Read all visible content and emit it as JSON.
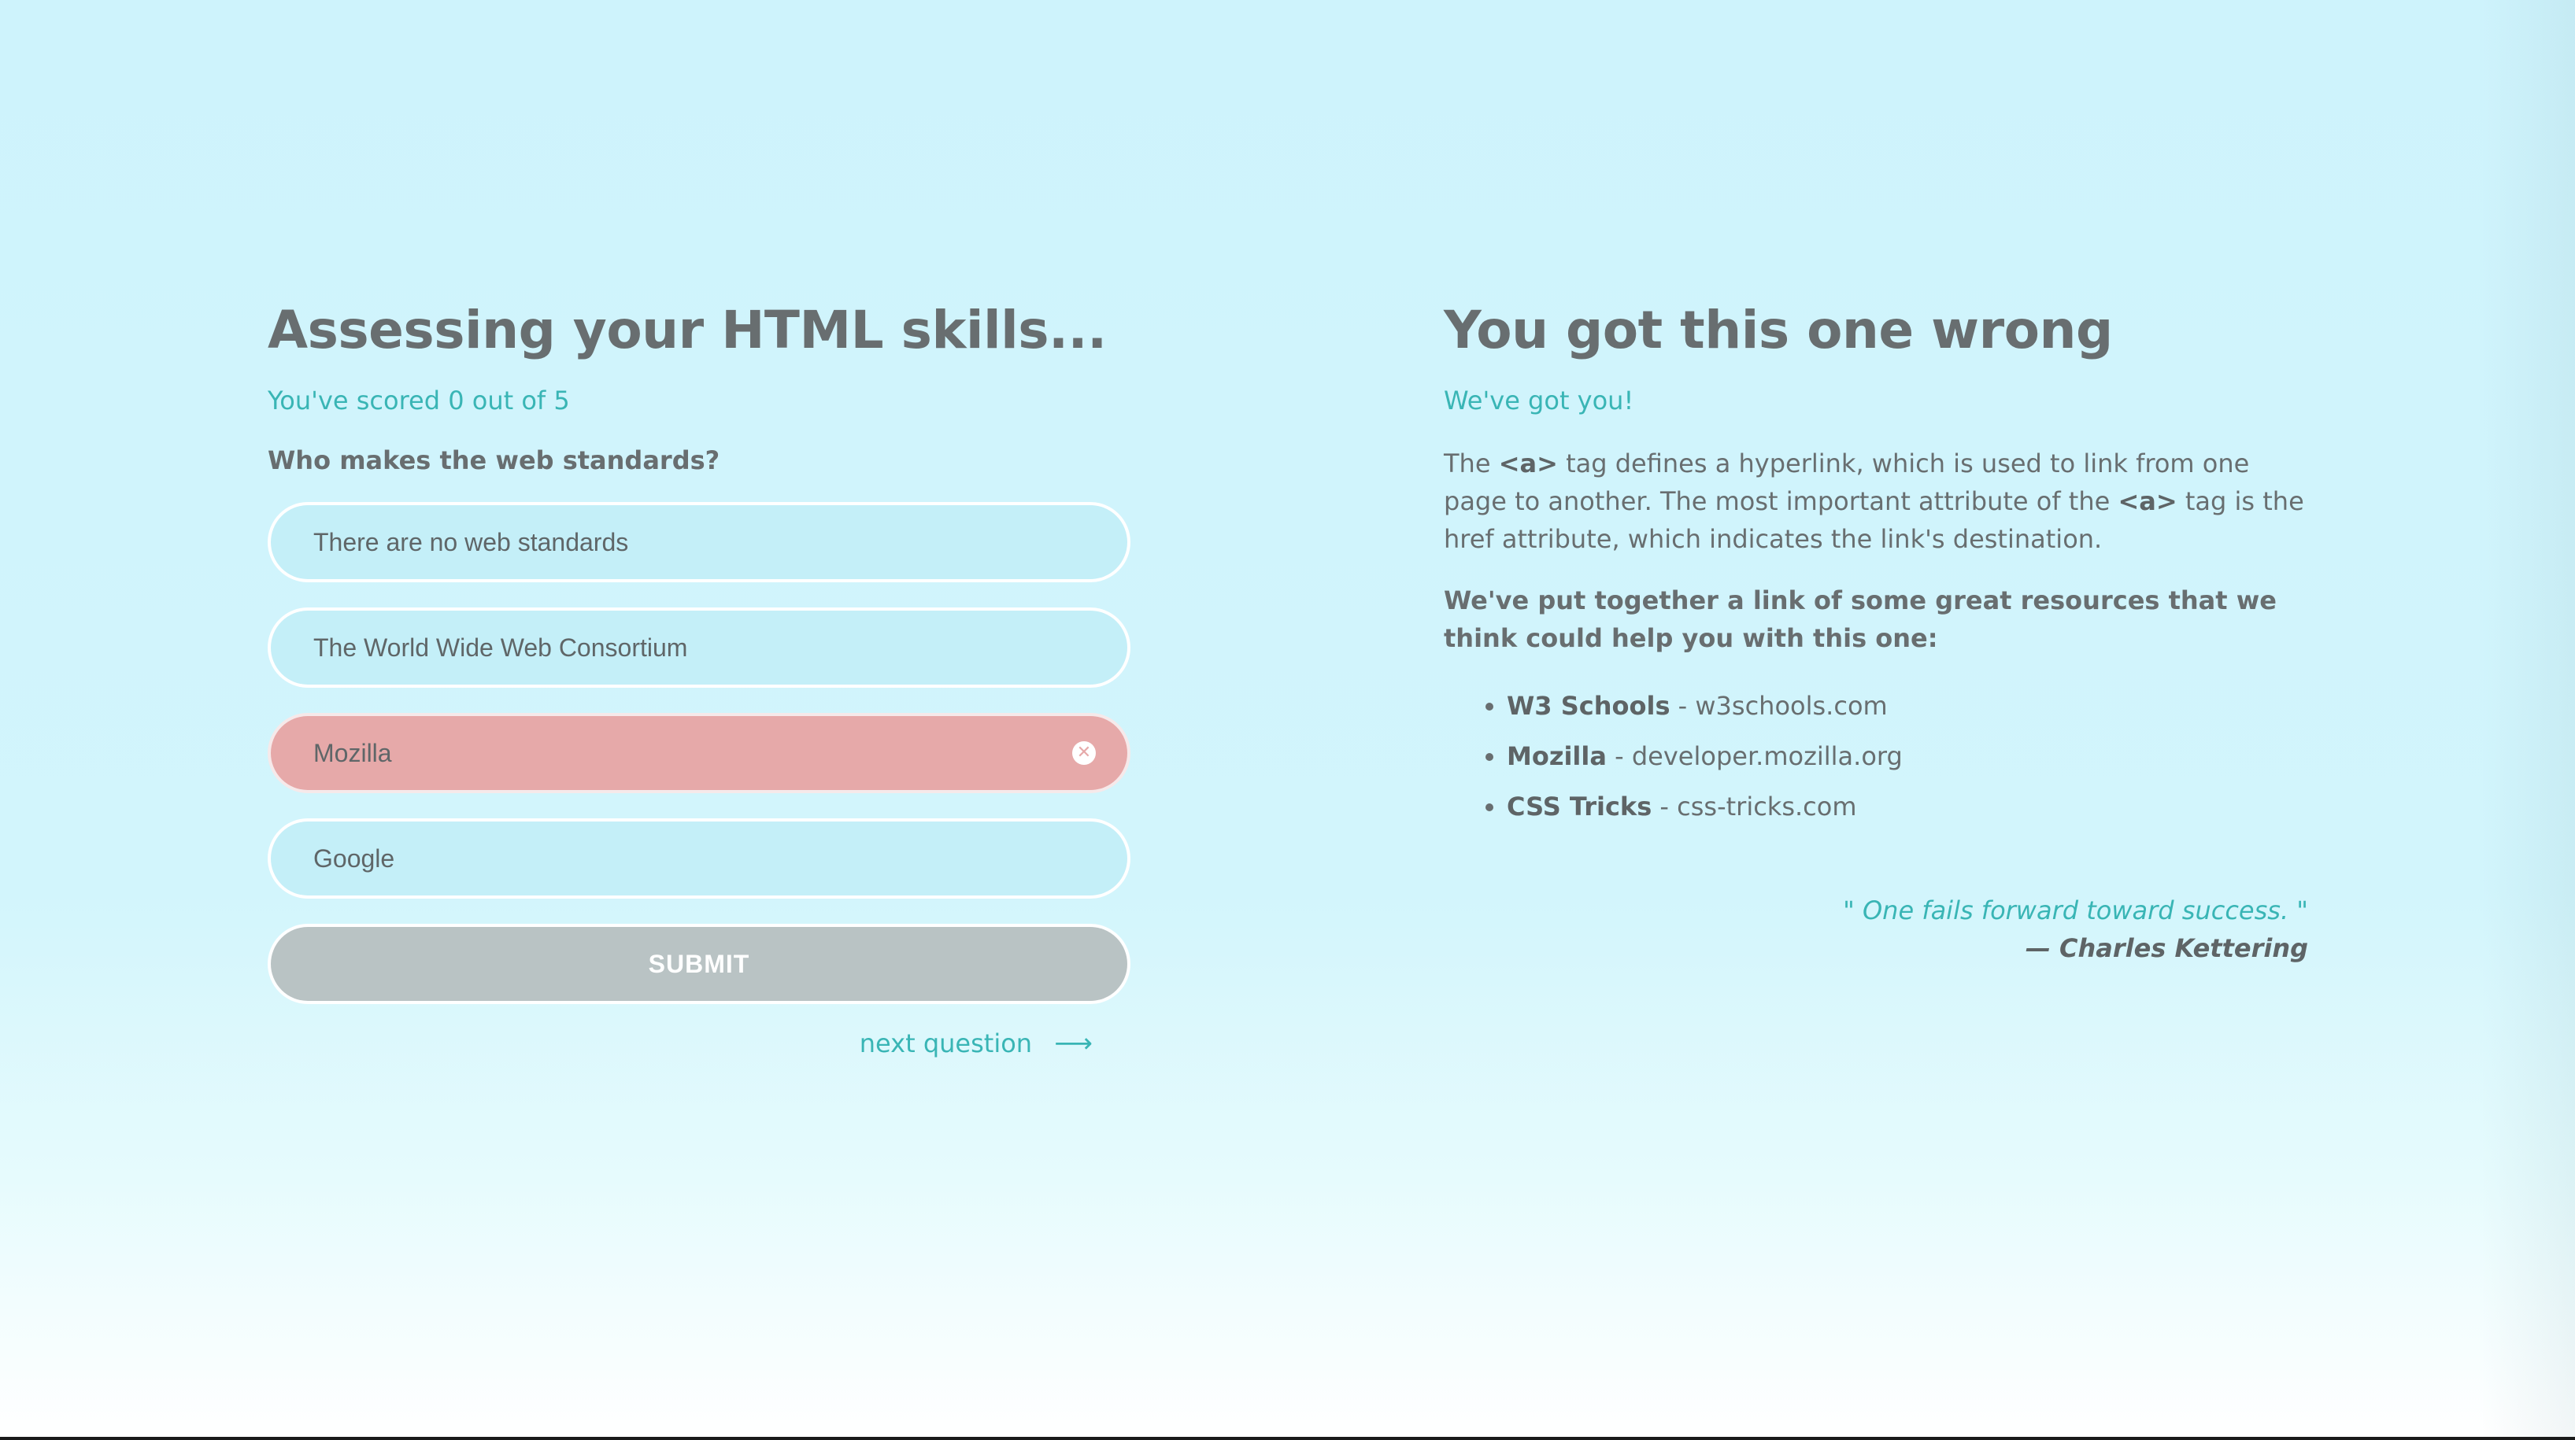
{
  "quiz": {
    "title": "Assessing your HTML skills...",
    "score_text": "You've scored 0 out of 5",
    "question": "Who makes the web standards?",
    "options": [
      {
        "label": "There are no web standards",
        "state": "default"
      },
      {
        "label": "The World Wide Web Consortium",
        "state": "default"
      },
      {
        "label": "Mozilla",
        "state": "wrong"
      },
      {
        "label": "Google",
        "state": "default"
      }
    ],
    "submit_label": "SUBMIT",
    "next_label": "next question",
    "next_icon": "arrow-right-icon"
  },
  "feedback": {
    "title": "You got this one wrong",
    "subtitle": "We've got you!",
    "explanation": {
      "part1": "The ",
      "tag1": "<a>",
      "part2": " tag defines a hyperlink, which is used to link from one page to another. The most important attribute of the ",
      "tag2": "<a>",
      "part3": " tag is the href attribute, which indicates the link's destination."
    },
    "help_text": "We've put together a link of some great resources that we think could help you with this one:",
    "resources": [
      {
        "name": "W3 Schools",
        "url": "w3schools.com"
      },
      {
        "name": "Mozilla",
        "url": "developer.mozilla.org"
      },
      {
        "name": "CSS Tricks",
        "url": "css-tricks.com"
      }
    ],
    "separator": " - ",
    "quote": "\" One fails forward toward success. \"",
    "quote_author": "— Charles Kettering"
  },
  "colors": {
    "accent": "#39b5b5",
    "text": "#686e70",
    "wrong": "#e6a9a9",
    "option_bg": "#c4eff8",
    "submit_bg": "#b9c3c4"
  }
}
